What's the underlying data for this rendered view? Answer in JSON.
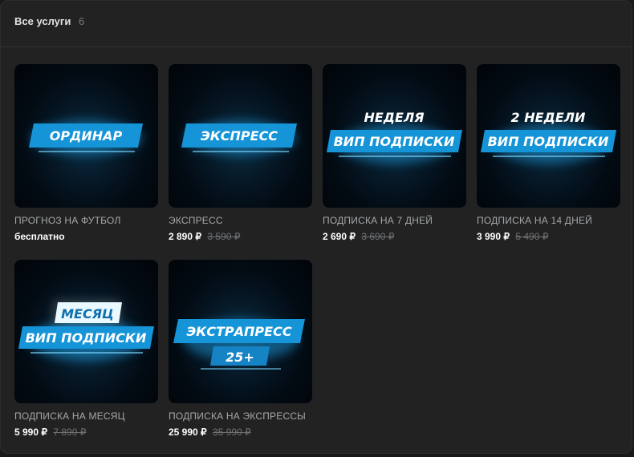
{
  "header": {
    "title": "Все услуги",
    "count": "6"
  },
  "colors": {
    "accent": "#1aa0e6",
    "glow": "#7fd8ff",
    "background": "#222222"
  },
  "products": [
    {
      "banner_lines": [
        "ОРДИНАР"
      ],
      "name": "ПРОГНОЗ НА ФУТБОЛ",
      "price": "бесплатно",
      "old_price": ""
    },
    {
      "banner_lines": [
        "ЭКСПРЕСС"
      ],
      "name": "ЭКСПРЕСС",
      "price": "2 890 ₽",
      "old_price": "3 590 ₽"
    },
    {
      "banner_lines": [
        "НЕДЕЛЯ",
        "ВИП ПОДПИСКИ"
      ],
      "name": "ПОДПИСКА НА 7 ДНЕЙ",
      "price": "2 690 ₽",
      "old_price": "3 690 ₽"
    },
    {
      "banner_lines": [
        "2 НЕДЕЛИ",
        "ВИП ПОДПИСКИ"
      ],
      "name": "ПОДПИСКА НА 14 ДНЕЙ",
      "price": "3 990 ₽",
      "old_price": "5 490 ₽"
    },
    {
      "banner_lines": [
        "МЕСЯЦ",
        "ВИП ПОДПИСКИ"
      ],
      "name": "ПОДПИСКА НА МЕСЯЦ",
      "price": "5 990 ₽",
      "old_price": "7 890 ₽"
    },
    {
      "banner_lines": [
        "ЭКСТРАПРЕСС",
        "25+"
      ],
      "name": "ПОДПИСКА НА ЭКСПРЕССЫ",
      "price": "25 990 ₽",
      "old_price": "35 990 ₽"
    }
  ]
}
